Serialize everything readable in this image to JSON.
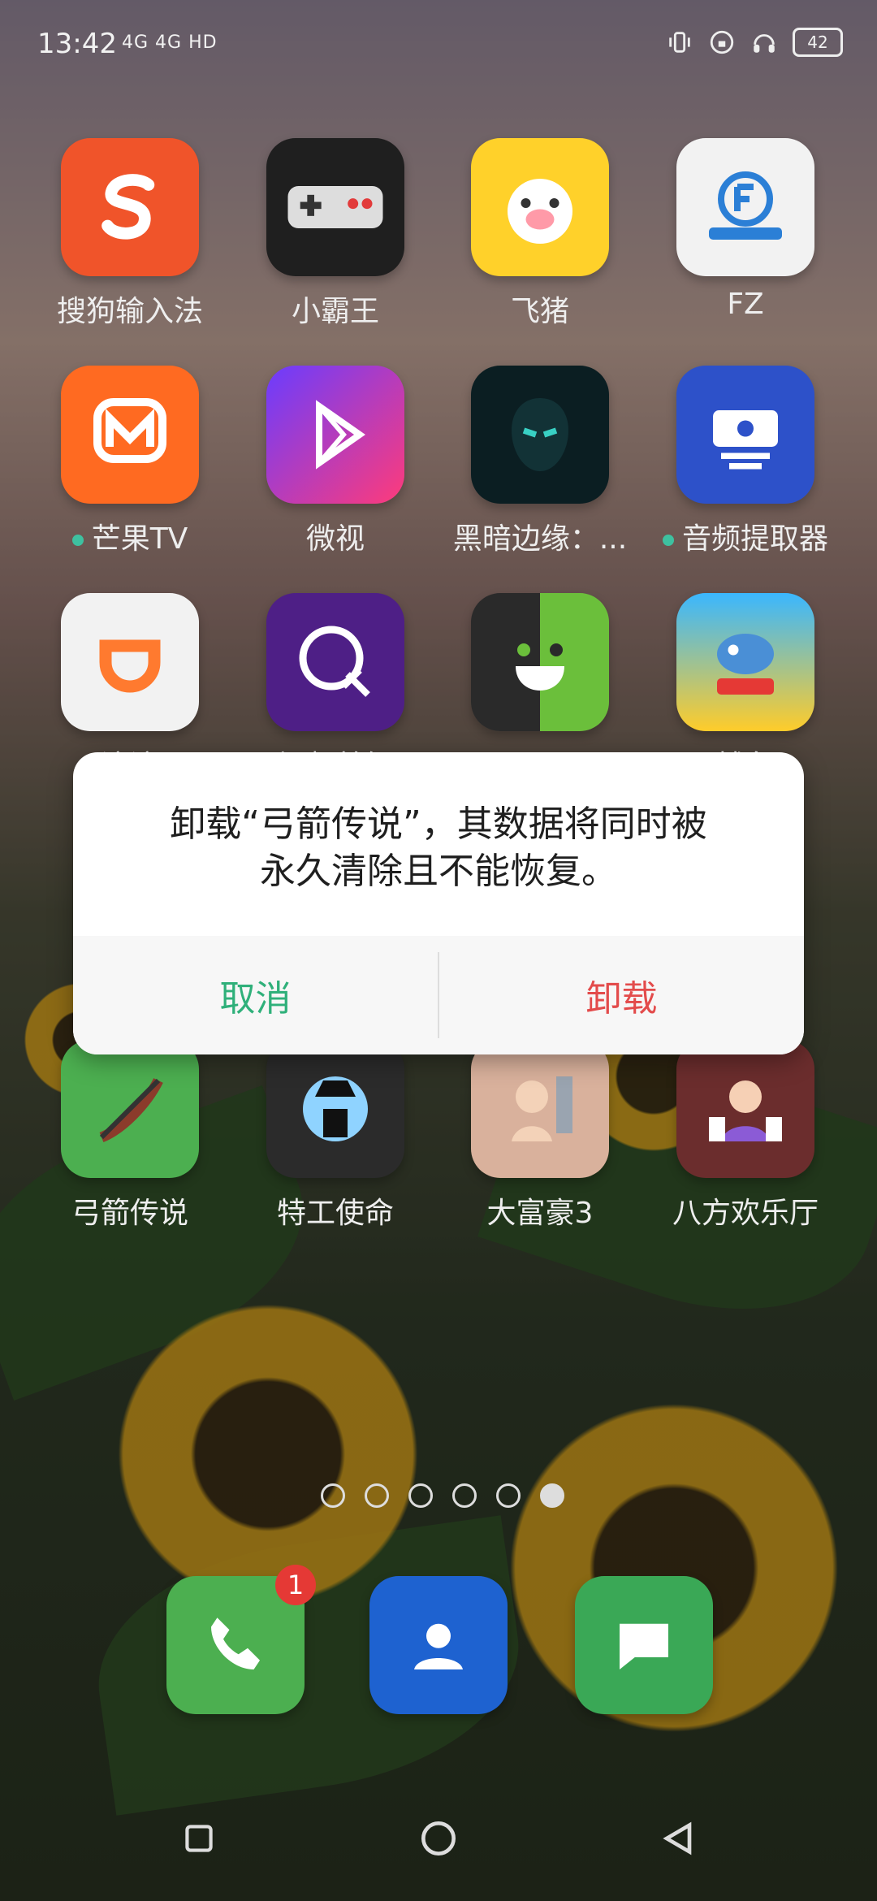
{
  "status_bar": {
    "time": "13:42",
    "network": "4G 4G HD",
    "battery": "42",
    "icons": [
      "vibrate-icon",
      "lock-rotation-icon",
      "headphones-icon",
      "battery-icon"
    ]
  },
  "apps": [
    {
      "label": "搜狗输入法",
      "icon": "sogou-icon",
      "color": "#f0542a",
      "dot": false
    },
    {
      "label": "小霸王",
      "icon": "gamepad-icon",
      "color": "#1f1f1f",
      "dot": false
    },
    {
      "label": "飞猪",
      "icon": "pig-icon",
      "color": "#ffd12a",
      "dot": false
    },
    {
      "label": "FZ",
      "icon": "fz-icon",
      "color": "#f2f2f2",
      "dot": false
    },
    {
      "label": "芒果TV",
      "icon": "mango-icon",
      "color": "#ff6a21",
      "dot": true
    },
    {
      "label": "微视",
      "icon": "play-icon",
      "color": "#7b3cff",
      "dot": false
    },
    {
      "label": "黑暗边缘：...",
      "icon": "dark-face-icon",
      "color": "#0b1e22",
      "dot": false
    },
    {
      "label": "音频提取器",
      "icon": "ticket-icon",
      "color": "#2d51c9",
      "dot": true
    },
    {
      "label": "滴滴",
      "icon": "didi-icon",
      "color": "#f2f2f2",
      "dot": false
    },
    {
      "label": "视频剪辑",
      "icon": "scissors-icon",
      "color": "#4e1f86",
      "dot": false
    },
    {
      "label": "面具",
      "icon": "mask-icon",
      "color": "#6bbf3b",
      "dot": false
    },
    {
      "label": "捕鱼",
      "icon": "fish-icon",
      "color": "#3ab7ff",
      "dot": false
    },
    {
      "label": "弓箭传说",
      "icon": "bow-icon",
      "color": "#4caf50",
      "dot": false
    },
    {
      "label": "特工使命",
      "icon": "agent-icon",
      "color": "#2b2b2b",
      "dot": false
    },
    {
      "label": "大富豪3",
      "icon": "rich-icon",
      "color": "#d9b19c",
      "dot": false
    },
    {
      "label": "八方欢乐厅",
      "icon": "cards-icon",
      "color": "#6b2d2d",
      "dot": false
    }
  ],
  "dialog": {
    "message_line1": "卸载“弓箭传说”，其数据将同时被",
    "message_line2": "永久清除且不能恢复。",
    "cancel": "取消",
    "uninstall": "卸载"
  },
  "pager": {
    "count": 6,
    "active_index": 5
  },
  "dock": {
    "phone": {
      "badge": "1",
      "icon": "phone-icon",
      "color": "#4caf50"
    },
    "contacts": {
      "icon": "contacts-icon",
      "color": "#1e62d0"
    },
    "messages": {
      "icon": "messages-icon",
      "color": "#3aa856"
    }
  }
}
